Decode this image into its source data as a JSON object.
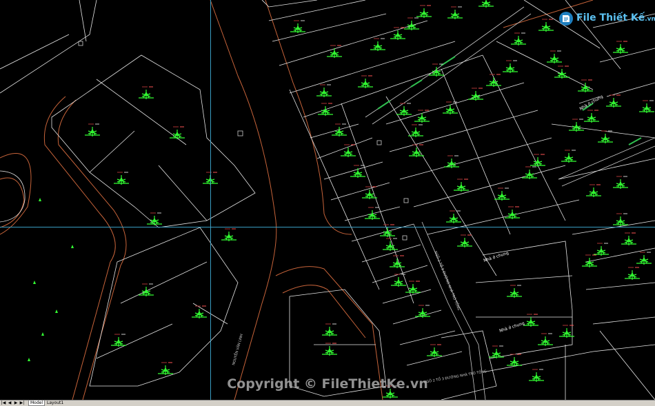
{
  "logo": {
    "text": "File Thiết Kế",
    "domain": ".vn",
    "color": "#5bc0f0"
  },
  "watermark": "Copyright © FileThietKe.vn",
  "tabs": {
    "nav_first": "|◀",
    "nav_prev": "◀",
    "nav_next": "▶",
    "nav_last": "▶|",
    "items": [
      "Model",
      "Layout1"
    ]
  },
  "cad": {
    "background": "#000000",
    "lot_line_color": "#ffffff",
    "road_color": "#d2693c",
    "tree_color": "#33ff33",
    "label_color": "#ff4444",
    "crosshair_color": "#3a9ec4",
    "road_labels": [
      "NGUYỄN VĂN LINH",
      "NGÕ 2 TỔ 3 ĐƯỜNG NHÀ TRÒ TỔNG",
      "NGÕ 2 TỔ 3 ĐƯỜNG NHÀ TRÒ TỔNG"
    ],
    "house_labels": [
      "Nhà ở chung",
      "Nhà ở chung",
      "Nhà ở chung"
    ]
  }
}
